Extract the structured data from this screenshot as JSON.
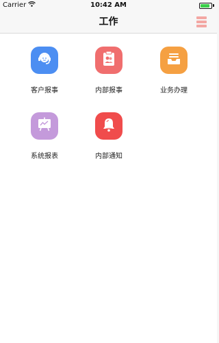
{
  "status_bar": {
    "carrier": "Carrier",
    "time": "10:42 AM",
    "battery_level": 0.85,
    "battery_color": "#3ad04a"
  },
  "nav": {
    "title": "工作",
    "menu_icon": "menu-icon",
    "menu_color": "#f3a7a3"
  },
  "apps": [
    {
      "label": "客户报事",
      "icon": "headset-agent-icon",
      "color": "#4c8ef2"
    },
    {
      "label": "内部报事",
      "icon": "badge-clipboard-icon",
      "color": "#f06e6e"
    },
    {
      "label": "业务办理",
      "icon": "tray-inbox-icon",
      "color": "#f5a042"
    },
    {
      "label": "系统报表",
      "icon": "chart-board-icon",
      "color": "#c49adb"
    },
    {
      "label": "内部通知",
      "icon": "bell-icon",
      "color": "#f04c4c"
    }
  ]
}
